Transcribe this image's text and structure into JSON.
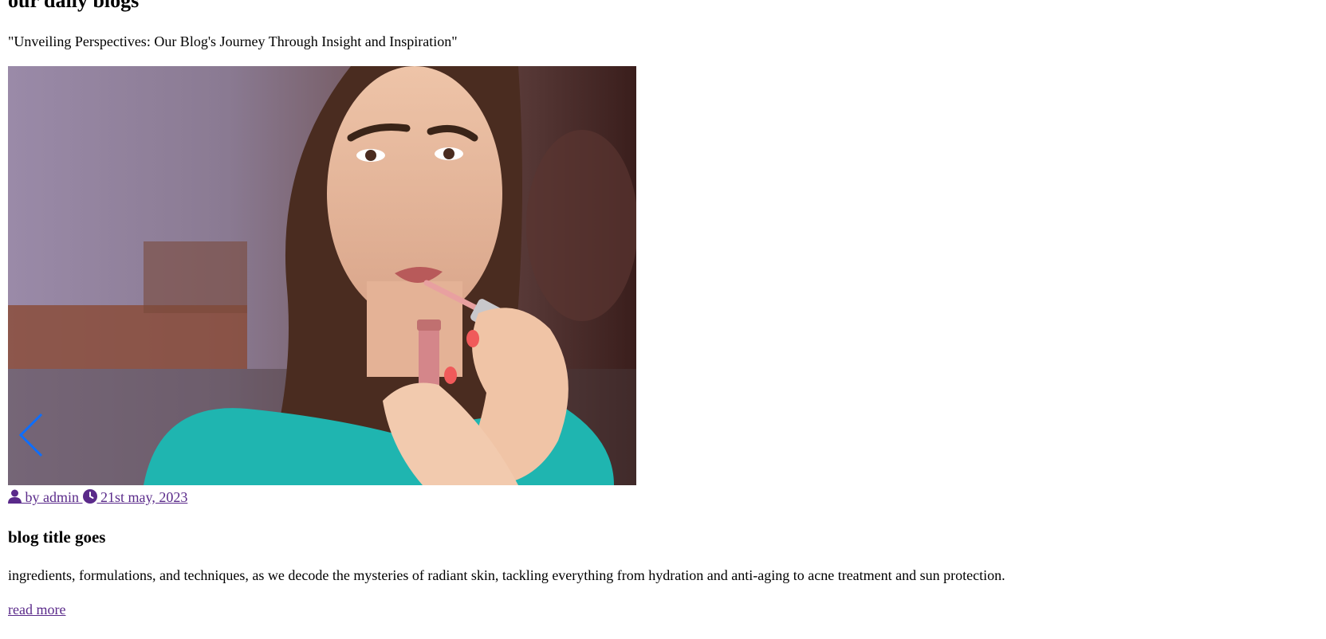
{
  "section": {
    "heading": "our daily blogs",
    "tagline": "\"Unveiling Perspectives: Our Blog's Journey Through Insight and Inspiration\""
  },
  "post": {
    "author": " by admin ",
    "date": " 21st may, 2023",
    "title": "blog title goes",
    "excerpt": "ingredients, formulations, and techniques, as we decode the mysteries of radiant skin, tackling everything from hydration and anti-aging to acne treatment and sun protection.",
    "read_more": "read more"
  },
  "icons": {
    "author": "user-icon",
    "date": "clock-icon",
    "slider_prev": "chevron-left-icon"
  },
  "colors": {
    "link": "#5a2a8a",
    "arrow": "#0d6efd",
    "shirt": "#1fb5b0",
    "backdrop": "#9a8aa8"
  }
}
